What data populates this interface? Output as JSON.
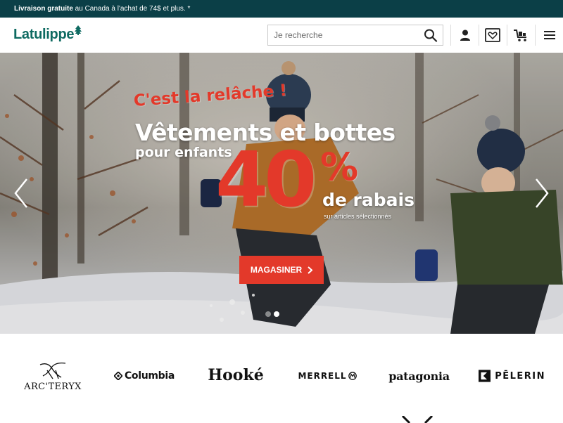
{
  "promo": {
    "bold": "Livraison gratuite",
    "rest": " au Canada à l'achat de 74$ et plus. *"
  },
  "header": {
    "logo": "Latulippe",
    "search_placeholder": "Je recherche",
    "icons": [
      "account-icon",
      "wishlist-icon",
      "cart-icon",
      "menu-icon"
    ]
  },
  "hero": {
    "tagline": "C'est la relâche !",
    "title": "Vêtements et bottes",
    "subtitle": "pour enfants",
    "discount_number": "40",
    "discount_symbol": "%",
    "discount_text": "de rabais",
    "note": "sur articles sélectionnés",
    "cta": "MAGASINER",
    "slides_total": 2,
    "active_slide": 2
  },
  "brands": [
    {
      "name": "ARC'TERYX"
    },
    {
      "name": "Columbia"
    },
    {
      "name": "Hooké"
    },
    {
      "name": "MERRELL"
    },
    {
      "name": "patagonia"
    },
    {
      "name": "PĒLERIN"
    }
  ],
  "colors": {
    "promo_bg": "#0b3f47",
    "logo": "#0e6a61",
    "accent_red": "#e3392a"
  }
}
